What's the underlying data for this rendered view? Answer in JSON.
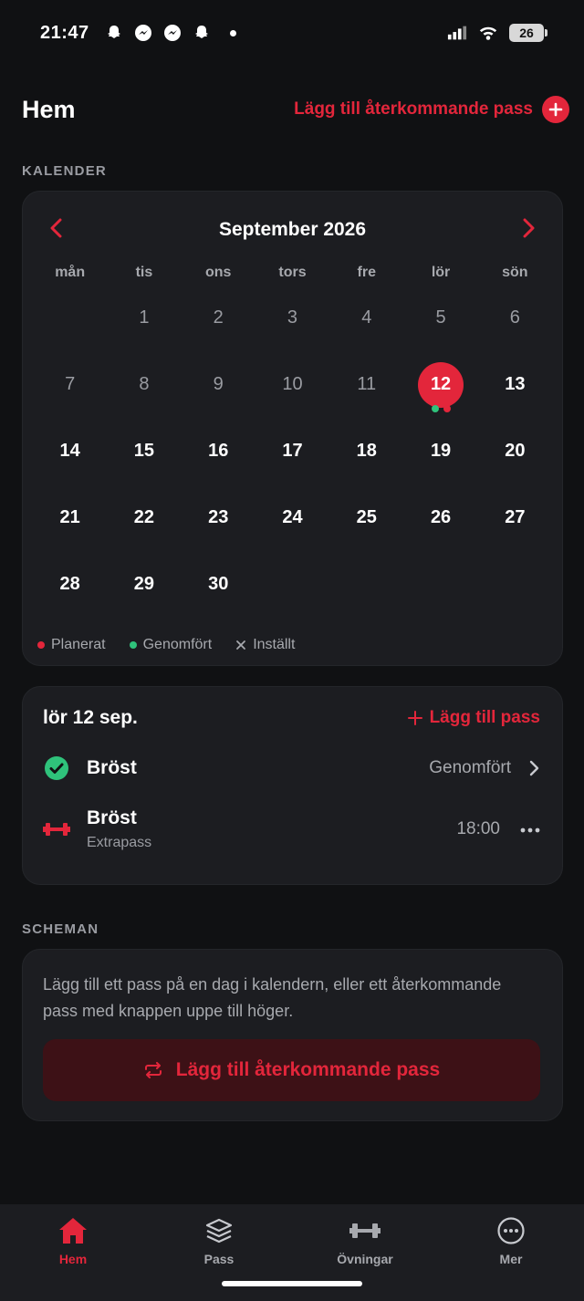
{
  "status_bar": {
    "time": "21:47",
    "battery": "26",
    "notification_icons": [
      "snapchat-icon",
      "messenger-icon",
      "messenger-icon",
      "snapchat-icon"
    ]
  },
  "header": {
    "title": "Hem",
    "add_recurring_label": "Lägg till återkommande pass"
  },
  "calendar": {
    "section_label": "KALENDER",
    "month_label": "September 2026",
    "weekdays": [
      "mån",
      "tis",
      "ons",
      "tors",
      "fre",
      "lör",
      "sön"
    ],
    "leading_blank_days": 1,
    "days": [
      "1",
      "2",
      "3",
      "4",
      "5",
      "6",
      "7",
      "8",
      "9",
      "10",
      "11",
      "12",
      "13",
      "14",
      "15",
      "16",
      "17",
      "18",
      "19",
      "20",
      "21",
      "22",
      "23",
      "24",
      "25",
      "26",
      "27",
      "28",
      "29",
      "30"
    ],
    "today": "12",
    "today_markers": [
      "completed",
      "planned"
    ],
    "legend": {
      "planned": "Planerat",
      "completed": "Genomfört",
      "cancelled": "Inställt"
    }
  },
  "day_panel": {
    "date_label": "lör 12 sep.",
    "add_pass_label": "Lägg till pass",
    "sessions": [
      {
        "name": "Bröst",
        "status": "Genomfört",
        "icon": "check-circle-icon"
      },
      {
        "name": "Bröst",
        "subtitle": "Extrapass",
        "time": "18:00",
        "icon": "dumbbell-icon"
      }
    ]
  },
  "schedules": {
    "section_label": "SCHEMAN",
    "text": "Lägg till ett pass på en dag i kalendern, eller ett återkommande pass med knappen uppe till höger.",
    "button_label": "Lägg till återkommande pass"
  },
  "tab_bar": {
    "tabs": [
      {
        "label": "Hem",
        "icon": "home-icon",
        "active": true
      },
      {
        "label": "Pass",
        "icon": "layers-icon",
        "active": false
      },
      {
        "label": "Övningar",
        "icon": "dumbbell-icon",
        "active": false
      },
      {
        "label": "Mer",
        "icon": "more-icon",
        "active": false
      }
    ]
  },
  "colors": {
    "accent": "#e3263b",
    "success": "#2fc27b",
    "background": "#101113",
    "card": "#1c1d21"
  }
}
